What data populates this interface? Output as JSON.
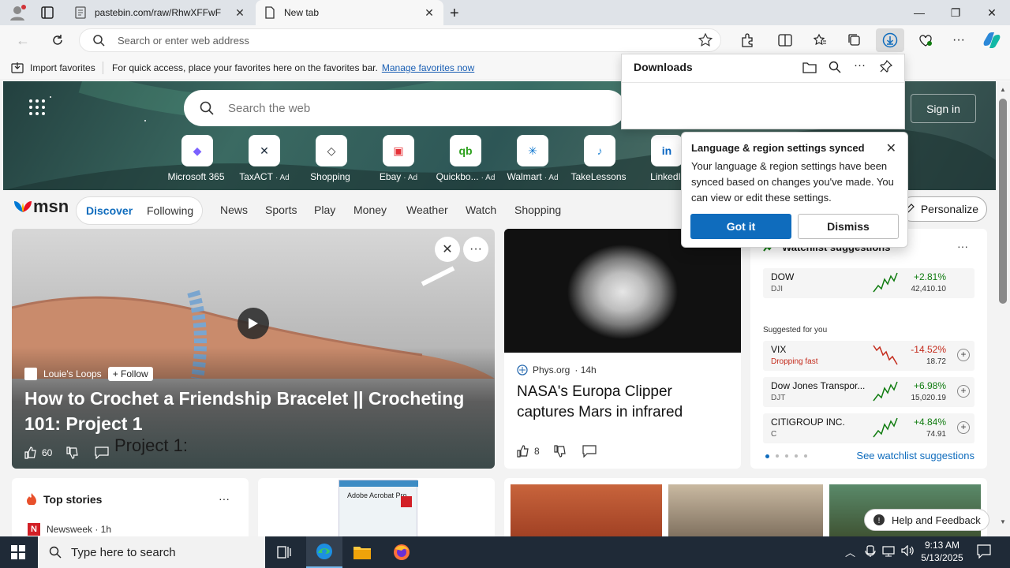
{
  "browser": {
    "tabs": [
      {
        "title": "pastebin.com/raw/RhwXFFwF"
      },
      {
        "title": "New tab"
      }
    ],
    "address_placeholder": "Search or enter web address",
    "favorites_bar": {
      "import_label": "Import favorites",
      "hint": "For quick access, place your favorites here on the favorites bar.",
      "manage_link": "Manage favorites now"
    }
  },
  "downloads_panel": {
    "title": "Downloads"
  },
  "language_popup": {
    "title": "Language & region settings synced",
    "body": "Your language & region settings have been synced based on changes you've made. You can view or edit these settings.",
    "primary": "Got it",
    "secondary": "Dismiss"
  },
  "newtab": {
    "search_placeholder": "Search the web",
    "signin": "Sign in",
    "tiles": [
      {
        "label": "Microsoft 365",
        "ad": "",
        "icon": "microsoft-365-icon",
        "glyph": "◆",
        "color": "#7b61ff"
      },
      {
        "label": "TaxACT",
        "ad": "· Ad",
        "icon": "taxact-icon",
        "glyph": "✕",
        "color": "#1b2a3a"
      },
      {
        "label": "Shopping",
        "ad": "",
        "icon": "shopping-tag-icon",
        "glyph": "◇",
        "color": "#333333"
      },
      {
        "label": "Ebay",
        "ad": "· Ad",
        "icon": "ebay-icon",
        "glyph": "▣",
        "color": "#e53238"
      },
      {
        "label": "Quickbo...",
        "ad": "· Ad",
        "icon": "quickbooks-icon",
        "glyph": "qb",
        "color": "#2ca01c"
      },
      {
        "label": "Walmart",
        "ad": "· Ad",
        "icon": "walmart-icon",
        "glyph": "✳",
        "color": "#0071ce"
      },
      {
        "label": "TakeLessons",
        "ad": "",
        "icon": "takelessons-icon",
        "glyph": "♪",
        "color": "#2b8ad6"
      },
      {
        "label": "LinkedI",
        "ad": "",
        "icon": "linkedin-icon",
        "glyph": "in",
        "color": "#0a66c2"
      }
    ],
    "msn": {
      "logo": "msn",
      "pill": {
        "discover": "Discover",
        "following": "Following"
      },
      "nav": [
        "News",
        "Sports",
        "Play",
        "Money",
        "Weather",
        "Watch",
        "Shopping"
      ],
      "personalize": "Personalize"
    }
  },
  "video_card": {
    "source": "Louie's Loops",
    "follow": "+ Follow",
    "title": "How to Crochet a Friendship Bracelet || Crocheting 101: Project 1",
    "likes": "60",
    "overlay": "Project 1:"
  },
  "nasa_card": {
    "source": "Phys.org",
    "age": "· 14h",
    "title": "NASA's Europa Clipper captures Mars in infrared",
    "likes": "8"
  },
  "watchlist": {
    "title": "Watchlist suggestions",
    "suggested_label": "Suggested for you",
    "see_more": "See watchlist suggestions",
    "stocks": [
      {
        "name": "DOW",
        "sub": "DJI",
        "change": "+2.81%",
        "price": "42,410.10",
        "dir": "up",
        "color": "#107c10"
      },
      {
        "name": "VIX",
        "sub": "Dropping fast",
        "change": "-14.52%",
        "price": "18.72",
        "dir": "down",
        "color": "#c42b1c"
      },
      {
        "name": "Dow Jones Transpor...",
        "sub": "DJT",
        "change": "+6.98%",
        "price": "15,020.19",
        "dir": "up",
        "color": "#107c10"
      },
      {
        "name": "CITIGROUP INC.",
        "sub": "C",
        "change": "+4.84%",
        "price": "74.91",
        "dir": "up",
        "color": "#107c10"
      }
    ]
  },
  "top_stories": {
    "title": "Top stories",
    "source": "Newsweek · 1h"
  },
  "acrobat_ad": {
    "title": "Adobe Acrobat Pro"
  },
  "help": "Help and Feedback",
  "taskbar": {
    "search_placeholder": "Type here to search",
    "time": "9:13 AM",
    "date": "5/13/2025"
  }
}
